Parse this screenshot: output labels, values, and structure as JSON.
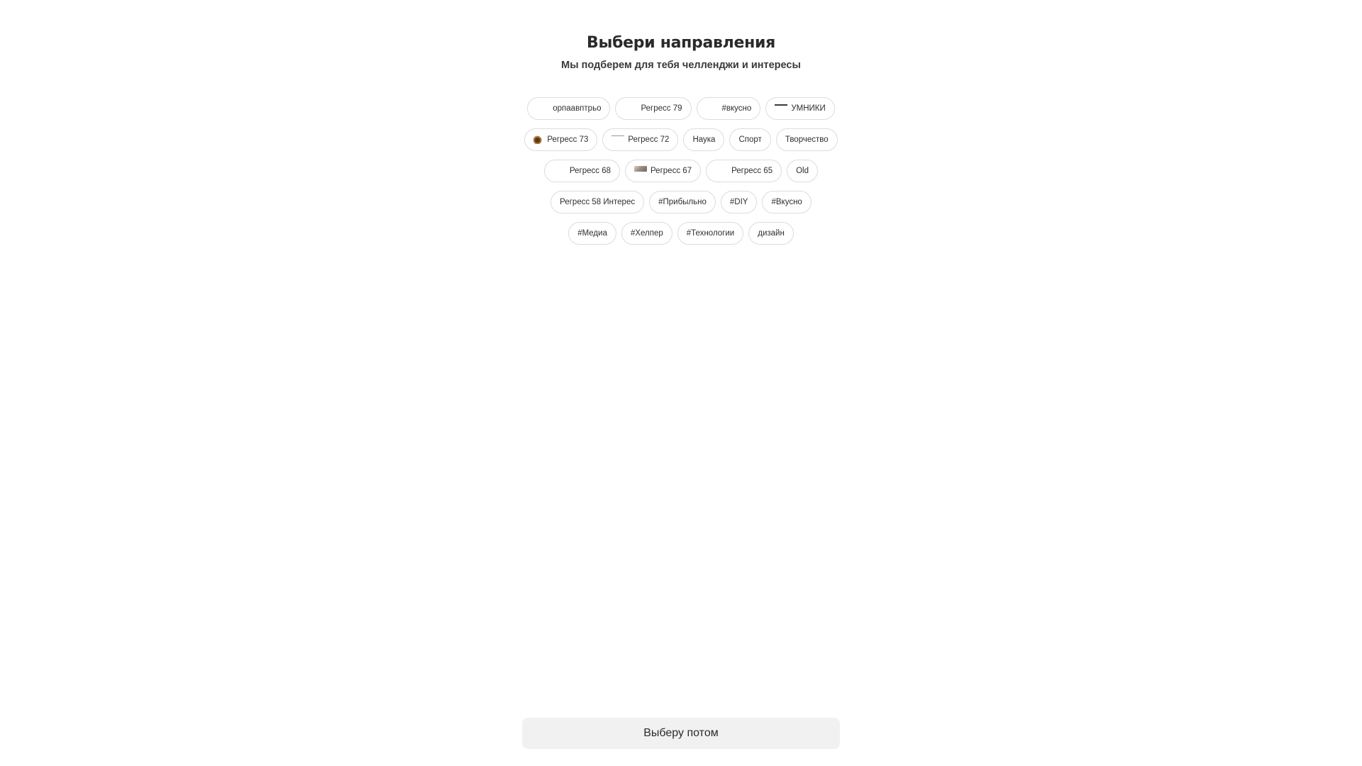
{
  "header": {
    "title": "Выбери направления",
    "subtitle": "Мы подберем для тебя челленджи и интересы"
  },
  "chips": {
    "rows": [
      [
        {
          "label": "орпаавптрьо",
          "icon": "blank-thumbnail"
        },
        {
          "label": "Регресс 79",
          "icon": "blank-thumbnail"
        },
        {
          "label": "#вкусно",
          "icon": "blank-thumbnail"
        },
        {
          "label": "УМНИКИ",
          "icon": "line-thumbnail"
        }
      ],
      [
        {
          "label": "Регресс 73",
          "icon": "squirrel-thumbnail"
        },
        {
          "label": "Регресс 72",
          "icon": "line-thumbnail"
        },
        {
          "label": "Наука",
          "icon": null
        },
        {
          "label": "Спорт",
          "icon": null
        },
        {
          "label": "Творчество",
          "icon": null
        }
      ],
      [
        {
          "label": "Регресс 68",
          "icon": "blank-thumbnail"
        },
        {
          "label": "Регресс 67",
          "icon": "photo-thumbnail"
        },
        {
          "label": "Регресс 65",
          "icon": "blank-thumbnail"
        },
        {
          "label": "Old",
          "icon": null
        }
      ],
      [
        {
          "label": "Регресс 58 Интерес",
          "icon": null
        },
        {
          "label": "#Прибыльно",
          "icon": null
        },
        {
          "label": "#DIY",
          "icon": null
        },
        {
          "label": "#Вкусно",
          "icon": null
        }
      ],
      [
        {
          "label": "#Медиа",
          "icon": null
        },
        {
          "label": "#Хелпер",
          "icon": null
        },
        {
          "label": "#Технологии",
          "icon": null
        },
        {
          "label": "дизайн",
          "icon": null
        }
      ]
    ]
  },
  "footer": {
    "skip_label": "Выберу потом"
  },
  "colors": {
    "chip_border": "#dcdcdc",
    "button_bg": "#f1f1f1",
    "text": "#2b2b2b"
  }
}
